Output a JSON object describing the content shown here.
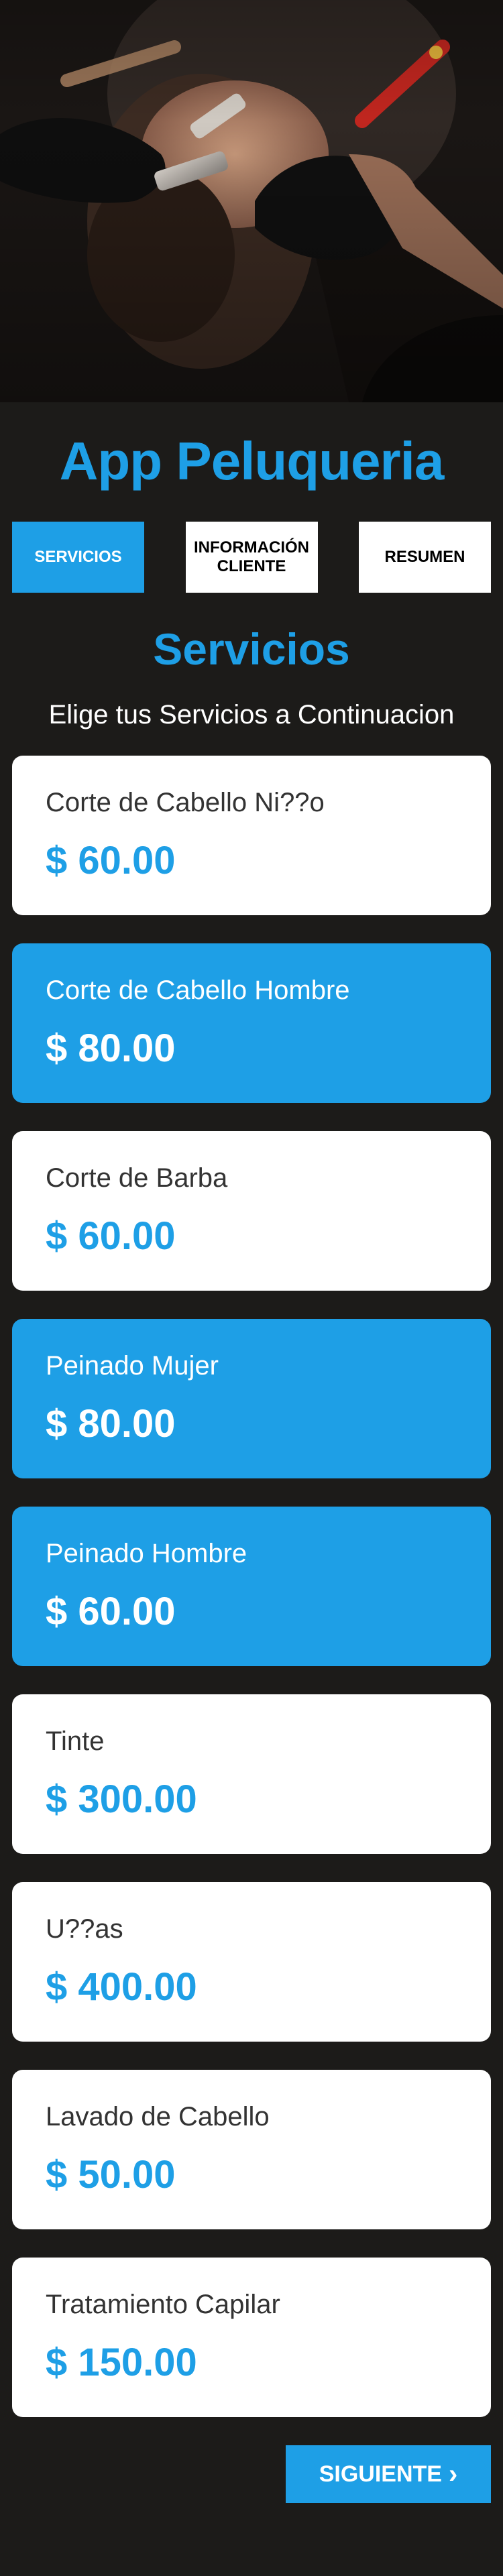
{
  "app_title": "App Peluqueria",
  "tabs": [
    {
      "label": "SERVICIOS",
      "active": true
    },
    {
      "label": "INFORMACIÓN CLIENTE",
      "active": false
    },
    {
      "label": "RESUMEN",
      "active": false
    }
  ],
  "section": {
    "title": "Servicios",
    "subtitle": "Elige tus Servicios a Continuacion"
  },
  "services": [
    {
      "name": "Corte de Cabello Ni??o",
      "price": "$ 60.00",
      "selected": false
    },
    {
      "name": "Corte de Cabello Hombre",
      "price": "$ 80.00",
      "selected": true
    },
    {
      "name": "Corte de Barba",
      "price": "$ 60.00",
      "selected": false
    },
    {
      "name": "Peinado Mujer",
      "price": "$ 80.00",
      "selected": true
    },
    {
      "name": "Peinado Hombre",
      "price": "$ 60.00",
      "selected": true
    },
    {
      "name": "Tinte",
      "price": "$ 300.00",
      "selected": false
    },
    {
      "name": "U??as",
      "price": "$ 400.00",
      "selected": false
    },
    {
      "name": "Lavado de Cabello",
      "price": "$ 50.00",
      "selected": false
    },
    {
      "name": "Tratamiento Capilar",
      "price": "$ 150.00",
      "selected": false
    }
  ],
  "next_button": {
    "label": "SIGUIENTE",
    "icon": "chevron-right-icon"
  },
  "colors": {
    "accent": "#1e9fe6",
    "background": "#1c1b19",
    "card": "#ffffff"
  }
}
